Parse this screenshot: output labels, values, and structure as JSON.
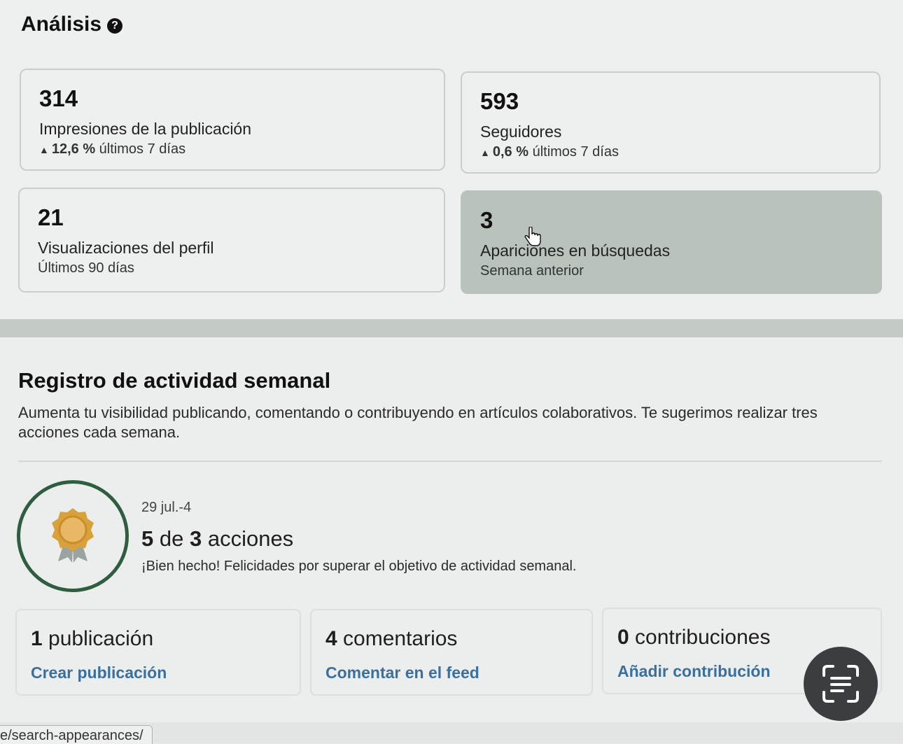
{
  "analytics": {
    "title": "Análisis",
    "help_icon": "?",
    "cards": [
      {
        "value": "314",
        "label": "Impresiones de la publicación",
        "trend_arrow": "▲",
        "trend": "12,6 %",
        "trend_suffix": " últimos 7 días"
      },
      {
        "value": "593",
        "label": "Seguidores",
        "trend_arrow": "▲",
        "trend": "0,6 %",
        "trend_suffix": " últimos 7 días"
      },
      {
        "value": "21",
        "label": "Visualizaciones del perfil",
        "sub": "Últimos 90 días"
      },
      {
        "value": "3",
        "label": "Apariciones en búsquedas",
        "sub": "Semana anterior"
      }
    ]
  },
  "activity": {
    "title": "Registro de actividad semanal",
    "description": "Aumenta tu visibilidad publicando, comentando o contribuyendo en artículos colaborativos. Te sugerimos realizar tres acciones cada semana.",
    "week_range": "29 jul.-4",
    "done": "5",
    "progress_mid": " de ",
    "goal": "3",
    "progress_suffix": " acciones",
    "congrats": "¡Bien hecho! Felicidades por superar el objetivo de actividad semanal.",
    "stats": [
      {
        "count": "1",
        "label": " publicación",
        "link": "Crear publicación"
      },
      {
        "count": "4",
        "label": " comentarios",
        "link": "Comentar en el feed"
      },
      {
        "count": "0",
        "label": " contribuciones",
        "link": "Añadir contribución"
      }
    ]
  },
  "status_url": "e/search-appearances/",
  "colors": {
    "accent_link": "#3a6f9e",
    "badge_ring": "#2f5d3f",
    "hover_card": "#b9c3bc"
  }
}
